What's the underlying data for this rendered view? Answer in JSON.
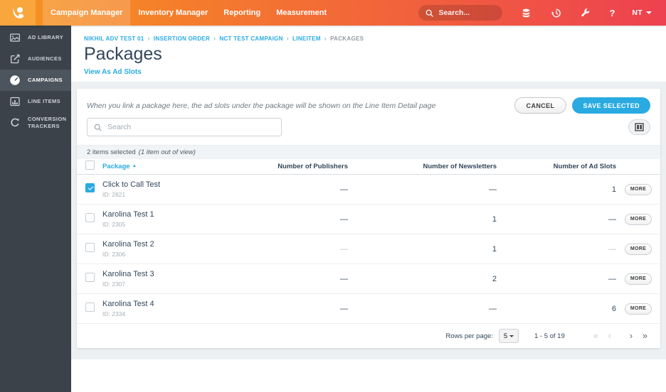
{
  "colors": {
    "accent": "#29ABE2",
    "topbar_left": "#F7941E",
    "topbar_right": "#EE4150",
    "logo_bg": "#F9A63C",
    "sidebar_bg": "#3B424A",
    "sidebar_active_bg": "#4C545D",
    "heading": "#33475B",
    "page_bg": "#EDF0F3"
  },
  "topbar": {
    "nav": [
      {
        "label": "Campaign Manager",
        "active": true
      },
      {
        "label": "Inventory Manager",
        "active": false
      },
      {
        "label": "Reporting",
        "active": false
      },
      {
        "label": "Measurement",
        "active": false
      }
    ],
    "search_placeholder": "Search...",
    "user_label": "NT",
    "help_label": "?"
  },
  "sidebar": {
    "items": [
      {
        "label": "AD LIBRARY",
        "active": false
      },
      {
        "label": "AUDIENCES",
        "active": false
      },
      {
        "label": "CAMPAIGNS",
        "active": true
      },
      {
        "label": "LINE ITEMS",
        "active": false
      },
      {
        "label": "CONVERSION TRACKERS",
        "active": false
      }
    ]
  },
  "page": {
    "breadcrumb": [
      {
        "label": "NIKHIL ADV TEST 01"
      },
      {
        "label": "INSERTION ORDER"
      },
      {
        "label": "NCT TEST CAMPAIGN"
      },
      {
        "label": "LINEITEM"
      },
      {
        "label": "PACKAGES"
      }
    ],
    "breadcrumb_separator": "›",
    "title": "Packages",
    "view_link": "View As Ad Slots"
  },
  "card": {
    "info_message": "When you link a package here, the ad slots under the package will be shown on the Line Item Detail page",
    "cancel_label": "CANCEL",
    "save_label": "SAVE SELECTED",
    "search_placeholder": "Search",
    "selection_text": "2 items selected",
    "selection_note": "(1 item out of view)",
    "table": {
      "columns": [
        "Package",
        "Number of Publishers",
        "Number of Newsletters",
        "Number of Ad Slots"
      ],
      "sort_icon": "▲",
      "more_label": "MORE",
      "rows": [
        {
          "name": "Click to Call Test",
          "id": "ID: 2821",
          "publishers": "—",
          "newsletters": "—",
          "ad_slots": "1",
          "checked": true,
          "muted": false
        },
        {
          "name": "Karolina Test 1",
          "id": "ID: 2305",
          "publishers": "—",
          "newsletters": "1",
          "ad_slots": "—",
          "checked": false,
          "muted": false
        },
        {
          "name": "Karolina Test 2",
          "id": "ID: 2306",
          "publishers": "—",
          "newsletters": "1",
          "ad_slots": "—",
          "checked": false,
          "muted": true
        },
        {
          "name": "Karolina Test 3",
          "id": "ID: 2307",
          "publishers": "—",
          "newsletters": "2",
          "ad_slots": "—",
          "checked": false,
          "muted": false
        },
        {
          "name": "Karolina Test 4",
          "id": "ID: 2334",
          "publishers": "—",
          "newsletters": "—",
          "ad_slots": "6",
          "checked": false,
          "muted": false
        }
      ]
    },
    "pagination": {
      "rows_per_page_label": "Rows per page:",
      "rows_per_page_value": "5",
      "range_text": "1 - 5 of 19",
      "first_icon": "«",
      "prev_icon": "‹",
      "next_icon": "›",
      "last_icon": "»",
      "first_disabled": true,
      "prev_disabled": true,
      "next_disabled": false,
      "last_disabled": false
    }
  }
}
